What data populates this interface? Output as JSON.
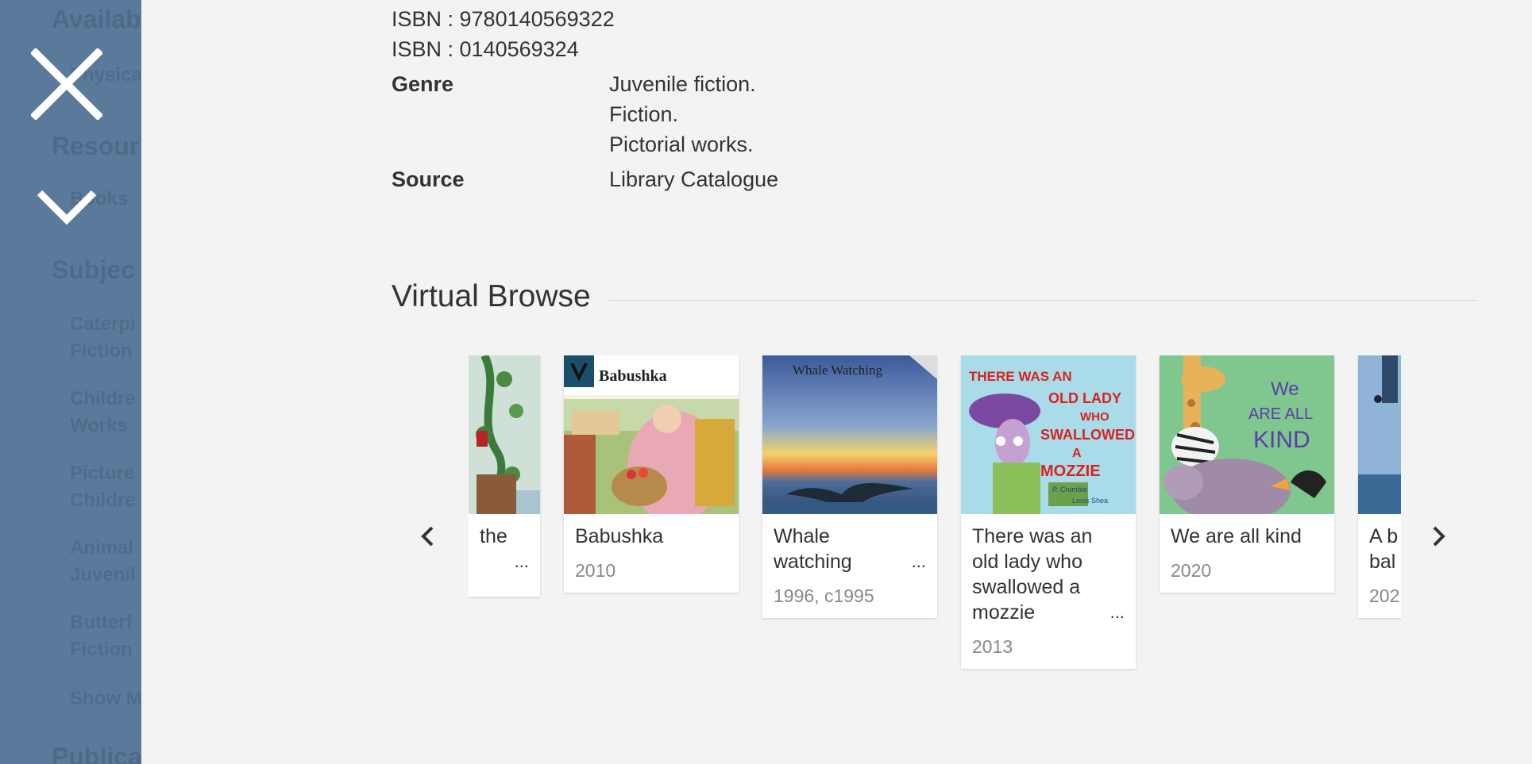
{
  "sidebar": {
    "headings": [
      "Availab",
      "Resour",
      "Subjec",
      "Publica"
    ],
    "items": [
      "Physica",
      "Books",
      "Caterpi",
      "Fiction",
      "Childre",
      "Works",
      "Picture",
      "Childre",
      "Animal",
      "Juvenil",
      "Butterf",
      "Fiction",
      "Show M"
    ],
    "close_icon": "close-icon",
    "collapse_icon": "chevron-down-icon"
  },
  "details": {
    "isbn_1": "ISBN : 9780140569322",
    "isbn_2": "ISBN : 0140569324",
    "genre_label": "Genre",
    "genres": [
      "Juvenile fiction.",
      "Fiction.",
      "Pictorial works."
    ],
    "source_label": "Source",
    "source_value": "Library Catalogue"
  },
  "virtual_browse": {
    "title": "Virtual Browse",
    "prev_icon": "chevron-left-icon",
    "next_icon": "chevron-right-icon",
    "books": [
      {
        "title_lines": [
          "the"
        ],
        "more": "...",
        "year": ""
      },
      {
        "title_lines": [
          "Babushka"
        ],
        "more": "",
        "year": "2010",
        "cover_text": "Babushka"
      },
      {
        "title_lines": [
          "Whale",
          "watching"
        ],
        "more": "...",
        "year": "1996, c1995",
        "cover_text": "Whale Watching"
      },
      {
        "title_lines": [
          "There was an",
          "old lady who",
          "swallowed a",
          "mozzie"
        ],
        "more": "...",
        "year": "2013",
        "cover_text": "THERE WAS AN OLD LADY WHO SWALLOWED A MOZZIE"
      },
      {
        "title_lines": [
          "We are all kind"
        ],
        "more": "",
        "year": "2020",
        "cover_text": "We Are All KIND"
      },
      {
        "title_lines": [
          "A b",
          "bal"
        ],
        "more": "",
        "year": "202"
      }
    ]
  },
  "colors": {
    "sidebar_overlay": "#5b7a9b",
    "background": "#f3f3f3",
    "card": "#ffffff",
    "muted_text": "#888888"
  }
}
